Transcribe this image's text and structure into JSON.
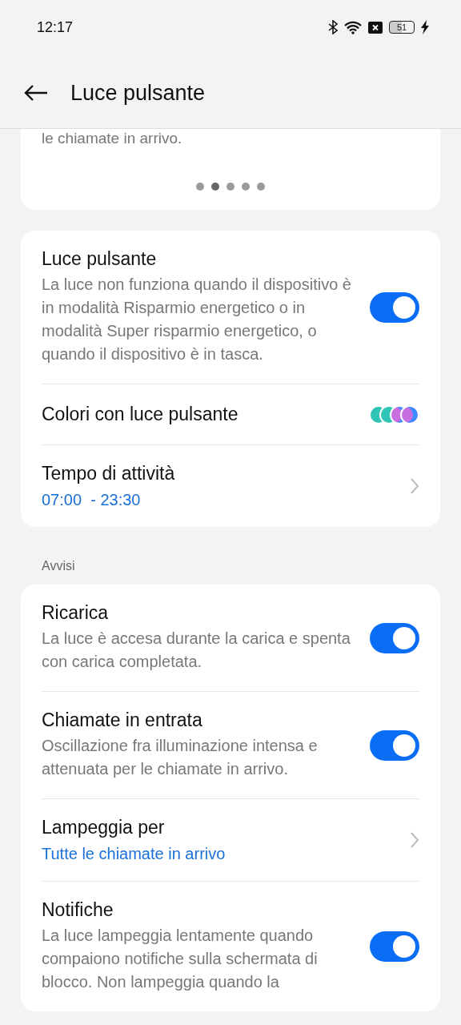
{
  "status_bar": {
    "time": "12:17",
    "battery": "51"
  },
  "header": {
    "title": "Luce pulsante"
  },
  "intro_card": {
    "text": "le chiamate in arrivo.",
    "pages": [
      {
        "selected": false
      },
      {
        "selected": true
      },
      {
        "selected": false
      },
      {
        "selected": false
      },
      {
        "selected": false
      }
    ]
  },
  "main_card": {
    "rows": [
      {
        "kind": "toggle",
        "title": "Luce pulsante",
        "description": "La luce non funziona quando il dispositivo è in modalità Risparmio energetico o in modalità Super risparmio energetico, o quando il dispositivo è in tasca.",
        "on": true
      },
      {
        "kind": "colors",
        "title": "Colori con luce pulsante",
        "colors": [
          {
            "color": "#2ec4b6"
          },
          {
            "color": "#2ec4b6"
          },
          {
            "color": "#c86ee0"
          },
          {
            "color": "#c86ee0"
          }
        ]
      },
      {
        "kind": "link",
        "title": "Tempo di attività",
        "value": "07:00  - 23:30"
      }
    ]
  },
  "section_label": "Avvisi",
  "alerts_card": {
    "rows": [
      {
        "kind": "toggle",
        "title": "Ricarica",
        "description": "La luce è accesa durante la carica e spenta con carica completata.",
        "on": true
      },
      {
        "kind": "toggle",
        "title": "Chiamate in entrata",
        "description": "Oscillazione fra illuminazione intensa e attenuata per le chiamate in arrivo.",
        "on": true
      },
      {
        "kind": "link",
        "title": "Lampeggia per",
        "value": "Tutte le chiamate in arrivo"
      },
      {
        "kind": "toggle",
        "title": "Notifiche",
        "description": "La luce lampeggia lentamente quando compaiono notifiche sulla schermata di blocco. Non lampeggia quando la",
        "on": true
      }
    ]
  }
}
